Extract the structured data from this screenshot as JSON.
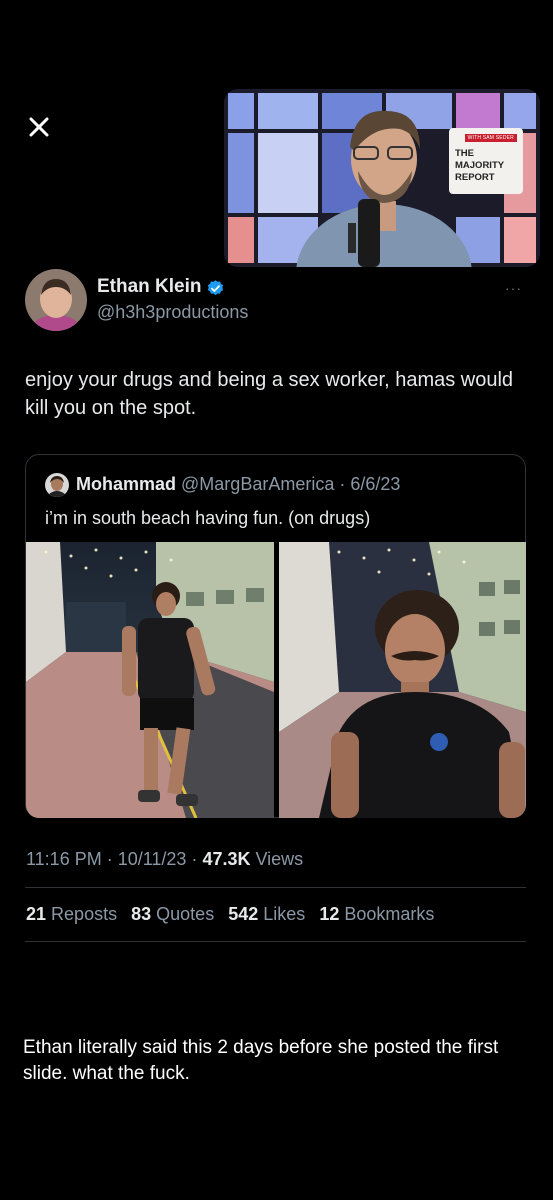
{
  "overlay": {
    "close_icon": "close-icon",
    "video": {
      "sign_tag": "WITH SAM SEDER",
      "sign_line1": "THE",
      "sign_line2": "MAJORITY",
      "sign_line3": "REPORT"
    }
  },
  "tweet": {
    "display_name": "Ethan Klein",
    "verified_icon": "verified-badge-icon",
    "handle": "@h3h3productions",
    "more_label": "···",
    "text": "enjoy your drugs and being a sex worker, hamas would kill you on the spot.",
    "quoted": {
      "name": "Mohammad",
      "meta": "@MargBarAmerica · 6/6/23",
      "text": "i’m in south beach having fun. (on drugs)"
    },
    "timestamp": "11:16 PM · 10/11/23 · ",
    "views_count": "47.3K",
    "views_label": " Views",
    "stats": {
      "reposts_count": "21",
      "reposts_label": "Reposts",
      "quotes_count": "83",
      "quotes_label": "Quotes",
      "likes_count": "542",
      "likes_label": "Likes",
      "bookmarks_count": "12",
      "bookmarks_label": "Bookmarks"
    }
  },
  "caption": "Ethan literally said this 2 days before she posted the first slide. what the fuck.",
  "colors": {
    "background": "#000000",
    "primary_text": "#e7e9ea",
    "secondary_text": "#8b98a5",
    "divider": "#2f3336",
    "verified": "#1d9bf0"
  }
}
